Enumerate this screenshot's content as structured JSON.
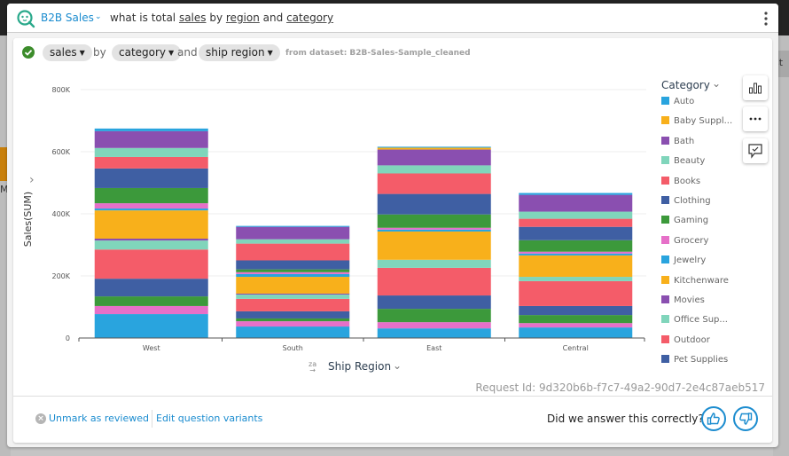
{
  "background": {
    "left_partial_text": "Me",
    "right_partial_text": "st f"
  },
  "header": {
    "topic": "B2B Sales",
    "question_parts": [
      {
        "text": "what is total ",
        "underline": false
      },
      {
        "text": "sales",
        "underline": true
      },
      {
        "text": " by ",
        "underline": false
      },
      {
        "text": "region",
        "underline": true
      },
      {
        "text": " and ",
        "underline": false
      },
      {
        "text": "category",
        "underline": true
      }
    ]
  },
  "interpretation": {
    "measure_chip": "sales",
    "by_word": "by",
    "dimension_chip_1": "category",
    "and_word": "and",
    "dimension_chip_2": "ship region",
    "dataset_note": "from dataset: B2B-Sales-Sample_cleaned"
  },
  "colors": {
    "accent": "#1b8ccf",
    "success": "#3c8c2b"
  },
  "chart_data": {
    "type": "bar",
    "stacked": true,
    "title": "",
    "xlabel": "Ship Region",
    "ylabel": "Sales(SUM)",
    "ylim": [
      0,
      800000
    ],
    "yticks": [
      0,
      200000,
      400000,
      600000,
      800000
    ],
    "ytick_labels": [
      "0",
      "200K",
      "400K",
      "600K",
      "800K"
    ],
    "grid": true,
    "legend_title": "Category",
    "legend_position": "right",
    "categories": [
      "West",
      "South",
      "East",
      "Central"
    ],
    "series": [
      {
        "name": "Auto",
        "color": "#29a4de",
        "values": [
          8600,
          3000,
          3000,
          6000
        ],
        "in_legend": true
      },
      {
        "name": "Baby Suppl...",
        "color": "#f8b01b",
        "values": [
          0,
          0,
          6000,
          0
        ],
        "in_legend": true
      },
      {
        "name": "Bath",
        "color": "#8a4fb0",
        "values": [
          54000,
          40000,
          51000,
          54000
        ],
        "in_legend": true
      },
      {
        "name": "Beauty",
        "color": "#80d5bb",
        "values": [
          29000,
          14000,
          26000,
          23000
        ],
        "in_legend": true
      },
      {
        "name": "Books",
        "color": "#f45c69",
        "values": [
          37000,
          54000,
          66000,
          26000
        ],
        "in_legend": true
      },
      {
        "name": "Clothing",
        "color": "#3f5fa3",
        "values": [
          63000,
          29000,
          66000,
          43000
        ],
        "in_legend": true
      },
      {
        "name": "Gaming",
        "color": "#3c993b",
        "values": [
          49000,
          9000,
          43000,
          37000
        ],
        "in_legend": true
      },
      {
        "name": "Grocery",
        "color": "#e670c8",
        "values": [
          17000,
          6000,
          6000,
          6000
        ],
        "in_legend": true
      },
      {
        "name": "Jewelry",
        "color": "#29a4de",
        "values": [
          6000,
          9000,
          6000,
          6000
        ],
        "in_legend": true
      },
      {
        "name": "Kitchenware",
        "color": "#f8b01b",
        "values": [
          91000,
          54000,
          91000,
          69000
        ],
        "in_legend": true
      },
      {
        "name": "Movies",
        "color": "#8a4fb0",
        "values": [
          6000,
          3000,
          0,
          0
        ],
        "in_legend": true
      },
      {
        "name": "Office Sup...",
        "color": "#80d5bb",
        "values": [
          29000,
          14000,
          26000,
          14000
        ],
        "in_legend": true
      },
      {
        "name": "Outdoor",
        "color": "#f45c69",
        "values": [
          94000,
          40000,
          89000,
          80000
        ],
        "in_legend": true
      },
      {
        "name": "Pet Supplies",
        "color": "#3f5fa3",
        "values": [
          57000,
          23000,
          43000,
          29000
        ],
        "in_legend": true
      },
      {
        "name": "",
        "color": "#3c993b",
        "values": [
          31000,
          9000,
          43000,
          26000
        ],
        "in_legend": false
      },
      {
        "name": "",
        "color": "#e670c8",
        "values": [
          26000,
          17000,
          20000,
          14000
        ],
        "in_legend": false
      },
      {
        "name": "",
        "color": "#29a4de",
        "values": [
          77000,
          37000,
          31000,
          34000
        ],
        "in_legend": false
      }
    ]
  },
  "footer": {
    "request_id": "Request Id: 9d320b6b-f7c7-49a2-90d7-2e4c87aeb517",
    "unmark_label": "Unmark as reviewed",
    "edit_variants_label": "Edit question variants",
    "feedback_question": "Did we answer this correctly?"
  }
}
